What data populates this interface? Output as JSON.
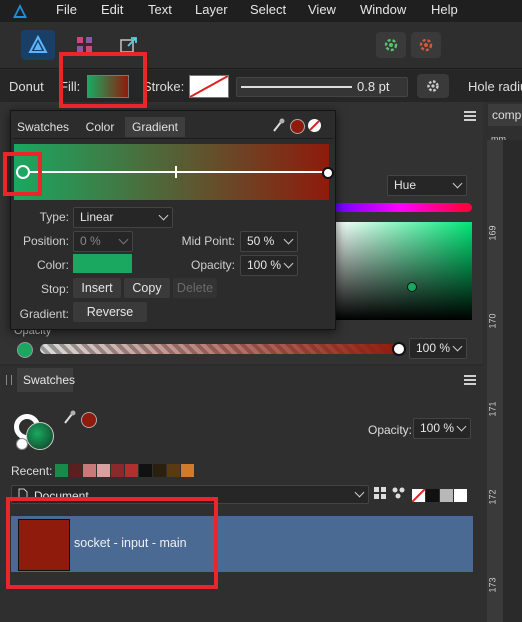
{
  "menu": {
    "items": [
      "File",
      "Edit",
      "Text",
      "Layer",
      "Select",
      "View",
      "Window",
      "Help"
    ]
  },
  "context_bar": {
    "shape_name": "Donut",
    "fill_label": "Fill:",
    "stroke_label": "Stroke:",
    "stroke_width": "0.8 pt",
    "stroke_width_fraction": 0.85,
    "hole_radius_label": "Hole radiu"
  },
  "canvas_tab": {
    "label": "comp"
  },
  "ruler": {
    "unit": "mm",
    "ticks": [
      "169",
      "170",
      "171",
      "172",
      "173"
    ]
  },
  "fill_popup": {
    "tabs": [
      "Swatches",
      "Color",
      "Gradient"
    ],
    "gradient_start_color": "#1aa860",
    "gradient_end_color": "#8f1b0c",
    "type_label": "Type:",
    "type_value": "Linear",
    "position_label": "Position:",
    "position_value": "0 %",
    "midpoint_label": "Mid Point:",
    "midpoint_value": "50 %",
    "color_label": "Color:",
    "color_value": "#1aa860",
    "opacity_label": "Opacity:",
    "opacity_value": "100 %",
    "stop_label": "Stop:",
    "insert_label": "Insert",
    "copy_label": "Copy",
    "delete_label": "Delete",
    "gradient_label": "Gradient:",
    "reverse_label": "Reverse"
  },
  "color_panel": {
    "mode_value": "Hue",
    "opacity_label": "Opacity",
    "opacity_value": "100 %"
  },
  "swatches_panel": {
    "tab_label": "Swatches",
    "opacity_label": "Opacity:",
    "opacity_value": "100 %",
    "recent_label": "Recent:",
    "recent_colors": [
      "#1a8a4a",
      "#5a1f1f",
      "#c87a7a",
      "#d9a0a0",
      "#8b2a2a",
      "#b03030",
      "#111111",
      "#2b1f10",
      "#5a3a10",
      "#d07a2a"
    ],
    "document_label": "Document",
    "selected_swatch_name": "socket - input - main",
    "selected_swatch_color": "#8f1b0c"
  },
  "colors": {
    "accent_red_highlight": "#e8262b",
    "selection_blue": "#4a6a94"
  }
}
